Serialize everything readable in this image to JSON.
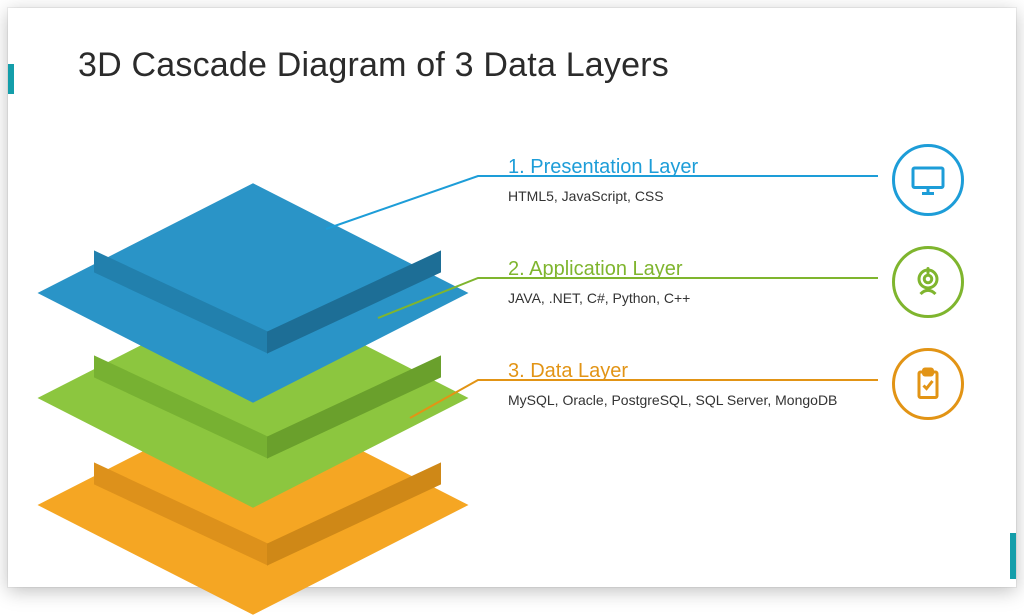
{
  "title": "3D Cascade Diagram of 3 Data Layers",
  "colors": {
    "blue": "#1d9dd8",
    "green": "#7fb52e",
    "orange": "#e29415"
  },
  "layers": [
    {
      "number": "1.",
      "name": "Presentation Layer",
      "heading": "1. Presentation Layer",
      "sub": "HTML5, JavaScript, CSS",
      "icon": "monitor-icon",
      "color": "blue"
    },
    {
      "number": "2.",
      "name": "Application Layer",
      "heading": "2. Application Layer",
      "sub": "JAVA, .NET, C#, Python, C++",
      "icon": "service-icon",
      "color": "green"
    },
    {
      "number": "3.",
      "name": "Data Layer",
      "heading": "3. Data Layer",
      "sub": "MySQL, Oracle, PostgreSQL, SQL Server, MongoDB",
      "icon": "clipboard-icon",
      "color": "orange"
    }
  ]
}
